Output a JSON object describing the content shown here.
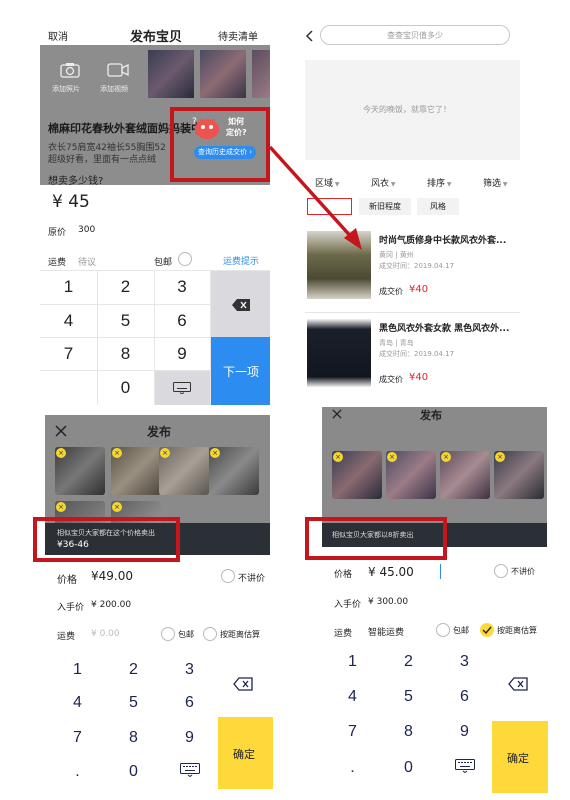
{
  "top_left": {
    "cancel": "取消",
    "title": "发布宝贝",
    "pending": "待卖清单",
    "add_photo": "添加照片",
    "add_video": "添加视频",
    "item_title": "棉麻印花春秋外套绒面妈妈装中",
    "desc_line1": "衣长75肩宽42袖长55胸围52",
    "desc_line2": "超级好看，里面有一点点绒",
    "bubble_line1": "如何",
    "bubble_line2": "定价?",
    "history_button": "查询历史成交价 ›",
    "price_question": "想卖多少钱?",
    "price": "¥ 45",
    "orig_label": "原价",
    "orig_value": "300",
    "ship_label": "运费",
    "ship_value": "待议",
    "free_ship": "包邮",
    "ship_tip": "运费提示",
    "keys": [
      "1",
      "2",
      "3",
      "4",
      "5",
      "6",
      "7",
      "8",
      "9",
      "0"
    ],
    "next": "下一项"
  },
  "top_right": {
    "search_placeholder": "查查宝贝值多少",
    "empty_text": "今天的晚饭，就靠它了！",
    "filters": [
      "区域",
      "风衣",
      "排序",
      "筛选"
    ],
    "tags": [
      "新旧程度",
      "风格"
    ],
    "items": [
      {
        "title": "时尚气质修身中长款风衣外套...",
        "location": "黄冈 | 黄州",
        "time": "成交时间：2019.04.17",
        "price_label": "成交价",
        "price": "¥40"
      },
      {
        "title": "黑色风衣外套女款 黑色风衣外...",
        "location": "青岛 | 青岛",
        "time": "成交时间：2019.04.17",
        "price_label": "成交价",
        "price": "¥40"
      }
    ]
  },
  "bottom_left": {
    "title": "发布",
    "hint_line1": "相似宝贝大家都在这个价格卖出",
    "hint_line2": "¥36-46",
    "price_label": "价格",
    "price_value": "¥49.00",
    "no_bargain": "不讲价",
    "buy_label": "入手价",
    "buy_value": "¥ 200.00",
    "ship_label": "运费",
    "ship_value": "¥ 0.00",
    "free_ship": "包邮",
    "by_distance": "按距离估算",
    "keys": [
      "1",
      "2",
      "3",
      "4",
      "5",
      "6",
      "7",
      "8",
      "9",
      ".",
      "0"
    ],
    "confirm": "确定"
  },
  "bottom_right": {
    "title": "发布",
    "hint": "相似宝贝大家都以8折卖出",
    "price_label": "价格",
    "price_value": "¥ 45.00",
    "no_bargain": "不讲价",
    "buy_label": "入手价",
    "buy_value": "¥ 300.00",
    "ship_label": "运费",
    "ship_value": "智能运费",
    "free_ship": "包邮",
    "by_distance": "按距离估算",
    "keys": [
      "1",
      "2",
      "3",
      "4",
      "5",
      "6",
      "7",
      "8",
      "9",
      ".",
      "0"
    ],
    "confirm": "确定"
  },
  "colors": {
    "accent_blue": "#2d8cf0",
    "price_red": "#e0242a",
    "confirm_yellow": "#ffd83a",
    "annotation_red": "#c4161c",
    "toast_dark": "#2b2f36"
  }
}
